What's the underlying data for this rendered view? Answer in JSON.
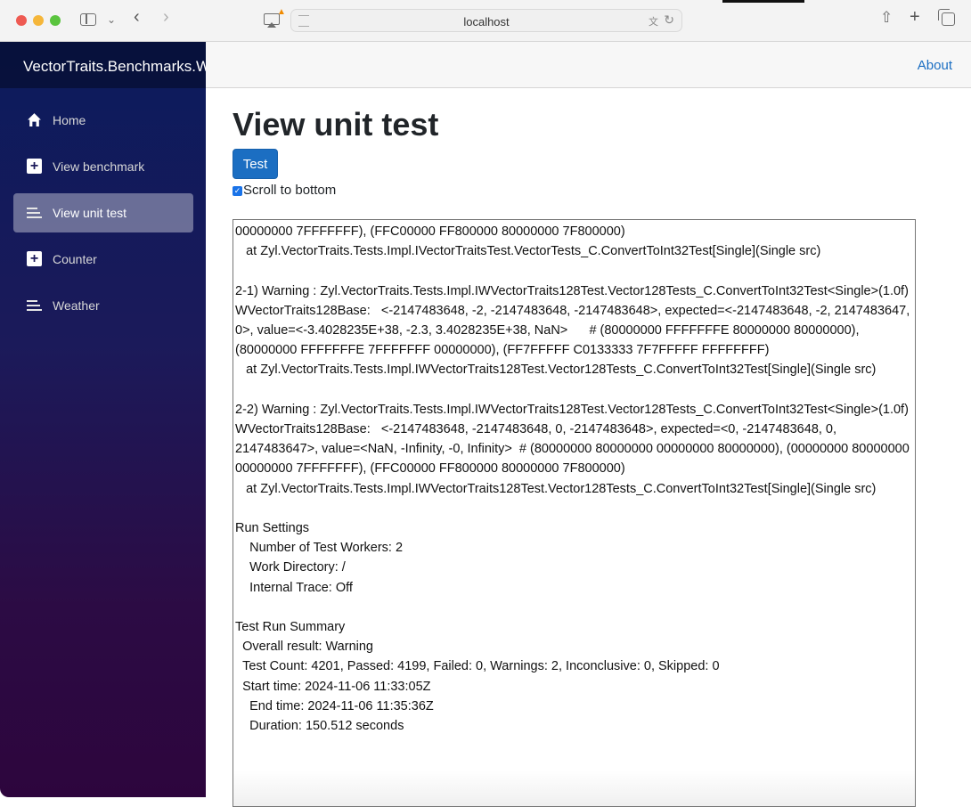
{
  "browser": {
    "url": "localhost",
    "icons": [
      "sidebar-toggle-icon",
      "chevron-down-icon",
      "back-icon",
      "forward-icon",
      "airplay-icon",
      "warning-icon",
      "page-icon",
      "translate-icon",
      "reload-icon",
      "share-icon",
      "new-tab-icon",
      "tab-overview-icon"
    ]
  },
  "sidebar": {
    "brand": "VectorTraits.Benchmarks.Wasm",
    "items": [
      {
        "label": "Home",
        "icon": "home-icon",
        "active": false
      },
      {
        "label": "View benchmark",
        "icon": "plus-icon",
        "active": false
      },
      {
        "label": "View unit test",
        "icon": "list-icon",
        "active": true
      },
      {
        "label": "Counter",
        "icon": "plus-icon",
        "active": false
      },
      {
        "label": "Weather",
        "icon": "list-icon",
        "active": false
      }
    ]
  },
  "topbar": {
    "about_label": "About"
  },
  "main": {
    "title": "View unit test",
    "test_button_label": "Test",
    "scroll_checkbox_label": "Scroll to bottom",
    "scroll_checkbox_checked": true
  },
  "output": {
    "lines": [
      "00000000 7FFFFFFF), (FFC00000 FF800000 80000000 7F800000)",
      "   at Zyl.VectorTraits.Tests.Impl.IVectorTraitsTest.VectorTests_C.ConvertToInt32Test[Single](Single src)",
      "",
      "2-1) Warning : Zyl.VectorTraits.Tests.Impl.IWVectorTraits128Test.Vector128Tests_C.ConvertToInt32Test<Single>(1.0f)",
      "WVectorTraits128Base:   <-2147483648, -2, -2147483648, -2147483648>, expected=<-2147483648, -2, 2147483647, 0>, value=<-3.4028235E+38, -2.3, 3.4028235E+38, NaN>      # (80000000 FFFFFFFE 80000000 80000000), (80000000 FFFFFFFE 7FFFFFFF 00000000), (FF7FFFFF C0133333 7F7FFFFF FFFFFFFF)",
      "   at Zyl.VectorTraits.Tests.Impl.IWVectorTraits128Test.Vector128Tests_C.ConvertToInt32Test[Single](Single src)",
      "",
      "2-2) Warning : Zyl.VectorTraits.Tests.Impl.IWVectorTraits128Test.Vector128Tests_C.ConvertToInt32Test<Single>(1.0f)",
      "WVectorTraits128Base:   <-2147483648, -2147483648, 0, -2147483648>, expected=<0, -2147483648, 0, 2147483647>, value=<NaN, -Infinity, -0, Infinity>  # (80000000 80000000 00000000 80000000), (00000000 80000000 00000000 7FFFFFFF), (FFC00000 FF800000 80000000 7F800000)",
      "   at Zyl.VectorTraits.Tests.Impl.IWVectorTraits128Test.Vector128Tests_C.ConvertToInt32Test[Single](Single src)",
      "",
      "Run Settings",
      "    Number of Test Workers: 2",
      "    Work Directory: /",
      "    Internal Trace: Off",
      "",
      "Test Run Summary",
      "  Overall result: Warning",
      "  Test Count: 4201, Passed: 4199, Failed: 0, Warnings: 2, Inconclusive: 0, Skipped: 0",
      "  Start time: 2024-11-06 11:33:05Z",
      "    End time: 2024-11-06 11:35:36Z",
      "    Duration: 150.512 seconds",
      ""
    ]
  },
  "colors": {
    "accent": "#1b6ec2",
    "sidebar_top": "#0b1b5c",
    "sidebar_bottom": "#2d053d"
  }
}
